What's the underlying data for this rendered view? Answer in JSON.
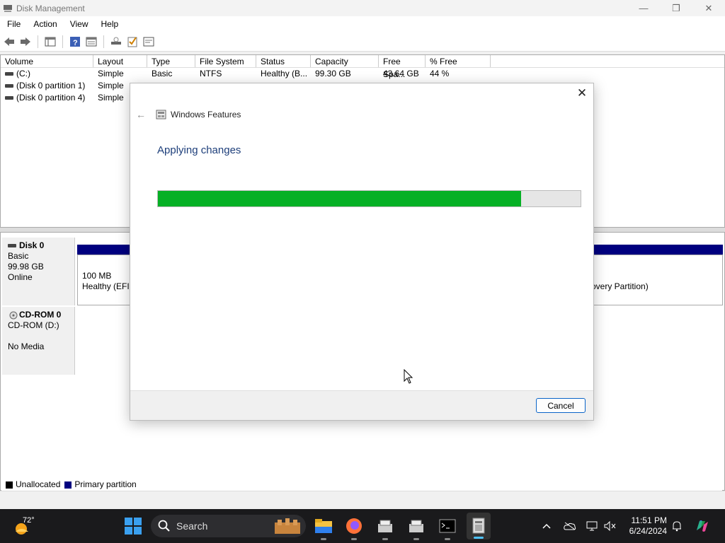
{
  "window": {
    "title": "Disk Management",
    "controls": [
      "minimize",
      "restore",
      "close"
    ]
  },
  "menu": [
    "File",
    "Action",
    "View",
    "Help"
  ],
  "toolbar_icons": [
    "back-icon",
    "forward-icon",
    "show-hide-console-tree-icon",
    "help-icon",
    "properties-icon",
    "rescan-icon",
    "check-icon",
    "settings-list-icon"
  ],
  "volume_table": {
    "columns": [
      "Volume",
      "Layout",
      "Type",
      "File System",
      "Status",
      "Capacity",
      "Free Spa...",
      "% Free"
    ],
    "rows": [
      {
        "volume": "(C:)",
        "layout": "Simple",
        "type": "Basic",
        "fs": "NTFS",
        "status": "Healthy (B...",
        "capacity": "99.30 GB",
        "free": "43.64 GB",
        "pct": "44 %"
      },
      {
        "volume": "(Disk 0 partition 1)",
        "layout": "Simple",
        "type": "",
        "fs": "",
        "status": "",
        "capacity": "",
        "free": "",
        "pct": ""
      },
      {
        "volume": "(Disk 0 partition 4)",
        "layout": "Simple",
        "type": "",
        "fs": "",
        "status": "",
        "capacity": "",
        "free": "",
        "pct": ""
      }
    ]
  },
  "disks": [
    {
      "name": "Disk 0",
      "type": "Basic",
      "size": "99.98 GB",
      "state": "Online",
      "part1_size": "100 MB",
      "part1_status": "Healthy (EFI S",
      "part_right_status": "overy Partition)"
    },
    {
      "name": "CD-ROM 0",
      "type": "CD-ROM (D:)",
      "state": "No Media"
    }
  ],
  "legend": {
    "unallocated": "Unallocated",
    "primary": "Primary partition",
    "unallocated_color": "#000000",
    "primary_color": "#00007f"
  },
  "dialog": {
    "title": "Windows Features",
    "heading": "Applying changes",
    "progress_fraction": 0.86,
    "cancel_label": "Cancel",
    "progress_color": "#06b025"
  },
  "taskbar": {
    "weather_temp": "72°",
    "search_label": "Search",
    "time": "11:51 PM",
    "date": "6/24/2024",
    "apps": [
      "file-explorer-icon",
      "firefox-icon",
      "app-icon-1",
      "app-icon-2",
      "terminal-icon",
      "disk-management-icon"
    ]
  }
}
